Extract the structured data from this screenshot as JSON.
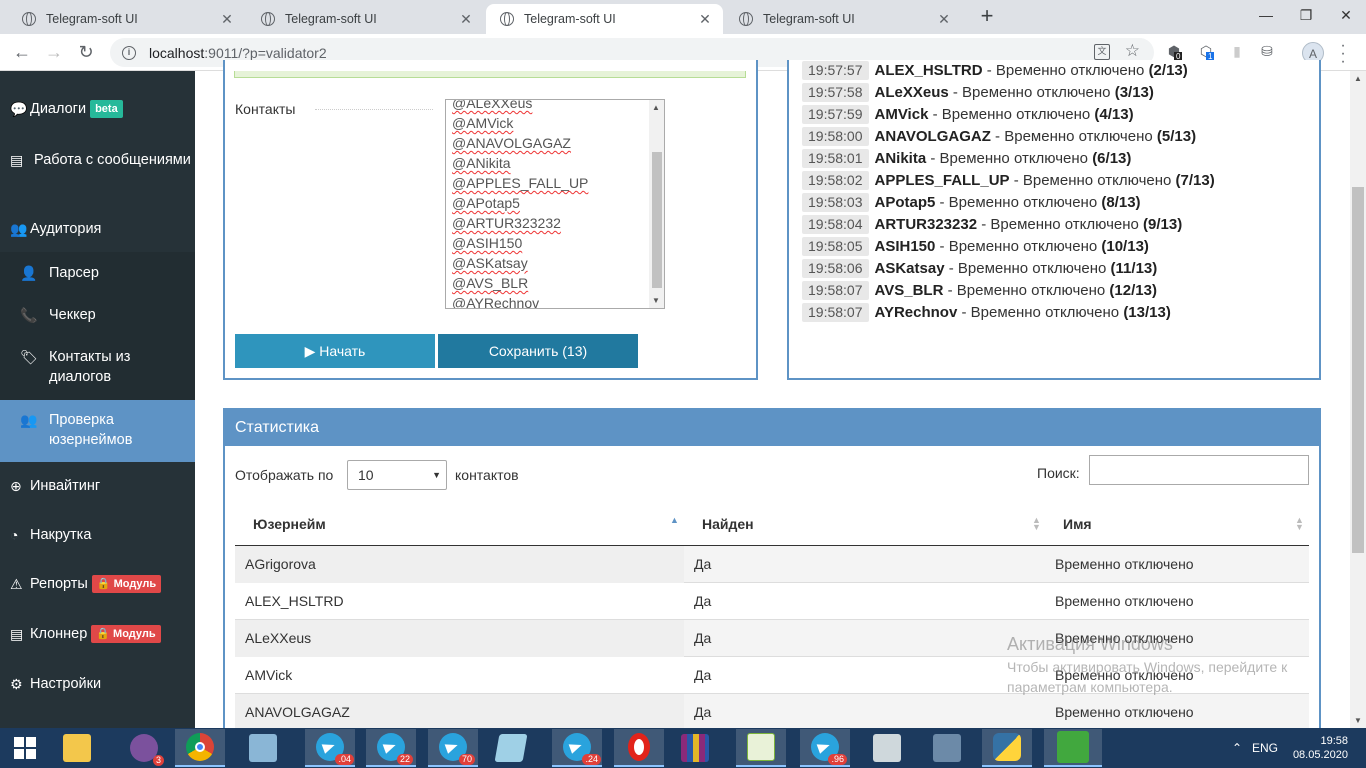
{
  "browser": {
    "tabs": [
      {
        "title": "Telegram-soft UI",
        "active": false
      },
      {
        "title": "Telegram-soft UI",
        "active": false
      },
      {
        "title": "Telegram-soft UI",
        "active": true
      },
      {
        "title": "Telegram-soft UI",
        "active": false
      }
    ],
    "url_host": "localhost",
    "url_rest": ":9011/?p=validator2",
    "extension_badges": [
      "0",
      "1"
    ],
    "profile_initial": "A"
  },
  "sidebar": {
    "items": [
      {
        "label": "Диалоги",
        "badge": "beta",
        "icon": "chat-icon"
      },
      {
        "label": "Работа с сообщениями",
        "icon": "list-icon"
      },
      {
        "label": "Аудитория",
        "icon": "users-icon"
      },
      {
        "label": "Парсер",
        "icon": "user-icon"
      },
      {
        "label": "Чеккер",
        "icon": "phone-icon"
      },
      {
        "label": "Контакты из диалогов",
        "icon": "tag-icon"
      },
      {
        "label": "Проверка юзернеймов",
        "icon": "group-icon"
      },
      {
        "label": "Инвайтинг",
        "icon": "plus-circle-icon"
      },
      {
        "label": "Накрутка",
        "icon": "dashboard-icon"
      },
      {
        "label": "Репорты",
        "badge": "🔒 Модуль",
        "icon": "warning-icon"
      },
      {
        "label": "Клоннер",
        "badge": "🔒 Модуль",
        "icon": "list-icon"
      },
      {
        "label": "Настройки",
        "icon": "gear-icon"
      }
    ]
  },
  "form": {
    "contacts_label": "Контакты",
    "contacts_list": [
      "@ALeXXeus",
      "@AMVick",
      "@ANAVOLGAGAZ",
      "@ANikita",
      "@APPLES_FALL_UP",
      "@APotap5",
      "@ARTUR323232",
      "@ASIH150",
      "@ASKatsay",
      "@AVS_BLR",
      "@AYRechnov"
    ],
    "start_button": "▶ Начать",
    "save_button": "Сохранить (13)"
  },
  "log": [
    {
      "time": "19:57:57",
      "user": "ALEX_HSLTRD",
      "status": " - Временно отключено ",
      "count": "(2/13)"
    },
    {
      "time": "19:57:58",
      "user": "ALeXXeus",
      "status": " - Временно отключено ",
      "count": "(3/13)"
    },
    {
      "time": "19:57:59",
      "user": "AMVick",
      "status": " - Временно отключено ",
      "count": "(4/13)"
    },
    {
      "time": "19:58:00",
      "user": "ANAVOLGAGAZ",
      "status": " - Временно отключено ",
      "count": "(5/13)"
    },
    {
      "time": "19:58:01",
      "user": "ANikita",
      "status": " - Временно отключено ",
      "count": "(6/13)"
    },
    {
      "time": "19:58:02",
      "user": "APPLES_FALL_UP",
      "status": " - Временно отключено ",
      "count": "(7/13)"
    },
    {
      "time": "19:58:03",
      "user": "APotap5",
      "status": " - Временно отключено ",
      "count": "(8/13)"
    },
    {
      "time": "19:58:04",
      "user": "ARTUR323232",
      "status": " - Временно отключено ",
      "count": "(9/13)"
    },
    {
      "time": "19:58:05",
      "user": "ASIH150",
      "status": " - Временно отключено ",
      "count": "(10/13)"
    },
    {
      "time": "19:58:06",
      "user": "ASKatsay",
      "status": " - Временно отключено ",
      "count": "(11/13)"
    },
    {
      "time": "19:58:07",
      "user": "AVS_BLR",
      "status": " - Временно отключено ",
      "count": "(12/13)"
    },
    {
      "time": "19:58:07",
      "user": "AYRechnov",
      "status": " - Временно отключено ",
      "count": "(13/13)"
    }
  ],
  "stats": {
    "title": "Статистика",
    "show_label": "Отображать по",
    "page_size": "10",
    "contacts_label": "контактов",
    "search_label": "Поиск:",
    "search_value": "",
    "columns": [
      "Юзернейм",
      "Найден",
      "Имя"
    ],
    "rows": [
      [
        "AGrigorova",
        "Да",
        "Временно отключено"
      ],
      [
        "ALEX_HSLTRD",
        "Да",
        "Временно отключено"
      ],
      [
        "ALeXXeus",
        "Да",
        "Временно отключено"
      ],
      [
        "AMVick",
        "Да",
        "Временно отключено"
      ],
      [
        "ANAVOLGAGAZ",
        "Да",
        "Временно отключено"
      ]
    ]
  },
  "watermark": {
    "title": "Активация Windows",
    "text": "Чтобы активировать Windows, перейдите к параметрам компьютера."
  },
  "taskbar": {
    "badges": [
      "3",
      ".04",
      "22",
      "70",
      ".24",
      ".96"
    ],
    "lang": "ENG",
    "time": "19:58",
    "date": "08.05.2020"
  },
  "colors": {
    "accent": "#5e93c5",
    "sidebar": "#263238",
    "button_start": "#2f95bd",
    "button_save": "#21799f"
  }
}
